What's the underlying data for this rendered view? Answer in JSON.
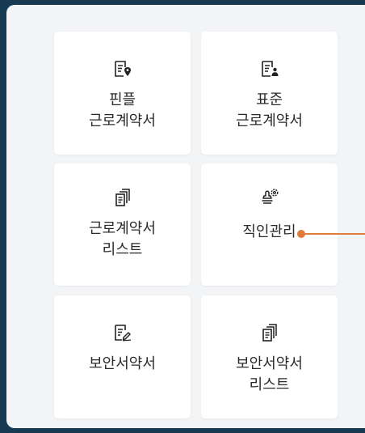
{
  "accent_color": "#e07b39",
  "menu": {
    "items": [
      {
        "label": "핀플\n근로계약서",
        "icon": "document-pin-icon"
      },
      {
        "label": "표준\n근로계약서",
        "icon": "document-person-icon"
      },
      {
        "label": "근로계약서\n리스트",
        "icon": "document-stack-icon"
      },
      {
        "label": "직인관리",
        "icon": "stamp-gear-icon"
      },
      {
        "label": "보안서약서",
        "icon": "document-sign-icon"
      },
      {
        "label": "보안서약서\n리스트",
        "icon": "document-stack-icon"
      }
    ]
  }
}
